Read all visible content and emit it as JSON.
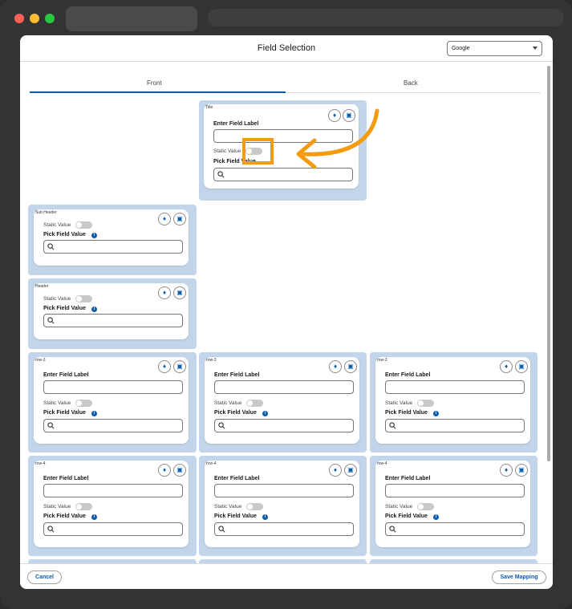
{
  "window": {
    "title": "Field Selection"
  },
  "header": {
    "select_value": "Google"
  },
  "tabs": {
    "front": "Front",
    "back": "Back"
  },
  "labels": {
    "enter_field_label": "Enter Field Label",
    "static_value": "Static Value",
    "pick_field_value": "Pick Field Value",
    "info_glyph": "i"
  },
  "cards": [
    {
      "title": "Title"
    },
    {
      "title": "Sub Header"
    },
    {
      "title": "Header"
    },
    {
      "title": "row-3"
    },
    {
      "title": "row-3"
    },
    {
      "title": "row-3"
    },
    {
      "title": "row-4"
    },
    {
      "title": "row-4"
    },
    {
      "title": "row-4"
    }
  ],
  "footer": {
    "cancel": "Cancel",
    "save": "Save Mapping"
  },
  "annotation": {
    "color": "#f39c12"
  },
  "colors": {
    "accent": "#0b5cab",
    "cell_bg": "#c3d5ea"
  },
  "icons": {
    "pin": "pin-icon",
    "delete": "trash-icon",
    "search": "search-icon",
    "info": "info-icon"
  }
}
